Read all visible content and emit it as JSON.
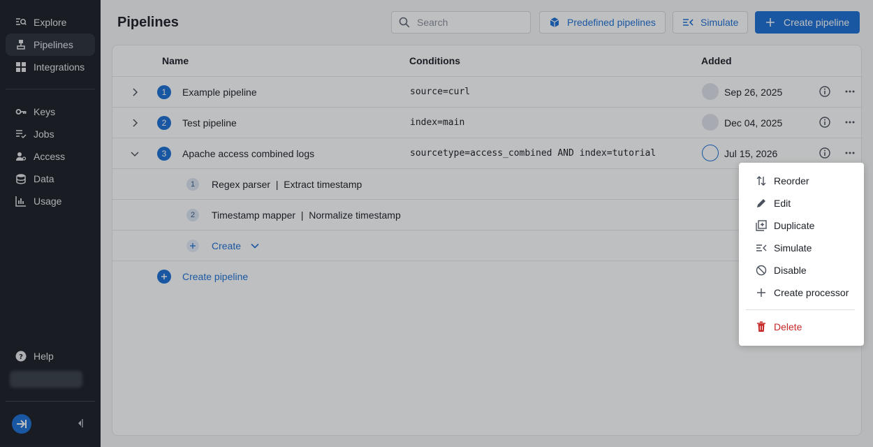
{
  "sidebar": {
    "nav": [
      {
        "label": "Explore",
        "icon": "explore-icon"
      },
      {
        "label": "Pipelines",
        "icon": "pipelines-icon",
        "active": true
      },
      {
        "label": "Integrations",
        "icon": "integrations-icon"
      },
      {
        "label": "Keys",
        "icon": "key-icon"
      },
      {
        "label": "Jobs",
        "icon": "jobs-icon"
      },
      {
        "label": "Access",
        "icon": "access-icon"
      },
      {
        "label": "Data",
        "icon": "database-icon"
      },
      {
        "label": "Usage",
        "icon": "usage-chart-icon"
      }
    ],
    "help_label": "Help"
  },
  "header": {
    "title": "Pipelines",
    "search_placeholder": "Search",
    "predefined_label": "Predefined pipelines",
    "simulate_label": "Simulate",
    "create_label": "Create pipeline"
  },
  "table": {
    "columns": [
      "Name",
      "Conditions",
      "Added"
    ],
    "rows": [
      {
        "index": "1",
        "name": "Example pipeline",
        "condition": "source=curl",
        "added": "Sep 26, 2025",
        "expanded": false
      },
      {
        "index": "2",
        "name": "Test pipeline",
        "condition": "index=main",
        "added": "Dec 04, 2025",
        "expanded": false
      },
      {
        "index": "3",
        "name": "Apache access combined logs",
        "condition": "sourcetype=access_combined AND index=tutorial",
        "added": "Jul 15, 2026",
        "expanded": true
      }
    ],
    "processors": [
      {
        "index": "1",
        "label": "Regex parser  |  Extract timestamp"
      },
      {
        "index": "2",
        "label": "Timestamp mapper  |  Normalize timestamp"
      }
    ],
    "create_processor_label": "Create",
    "create_pipeline_label": "Create pipeline"
  },
  "menu": {
    "items": [
      {
        "label": "Reorder",
        "icon": "reorder-icon"
      },
      {
        "label": "Edit",
        "icon": "pencil-icon"
      },
      {
        "label": "Duplicate",
        "icon": "duplicate-icon"
      },
      {
        "label": "Simulate",
        "icon": "simulate-icon"
      },
      {
        "label": "Disable",
        "icon": "disable-icon"
      },
      {
        "label": "Create processor",
        "icon": "plus-icon"
      }
    ],
    "delete_label": "Delete"
  },
  "colors": {
    "accent": "#1d6fd6",
    "sidebar_bg": "#1b1f26",
    "danger": "#c62828"
  }
}
